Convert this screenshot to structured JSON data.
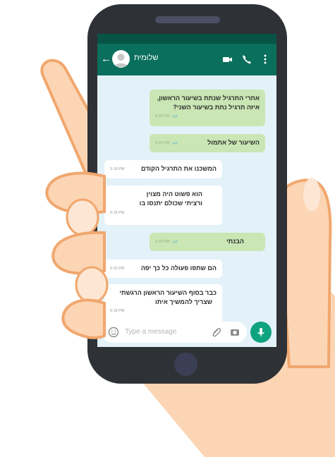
{
  "header": {
    "contact_name": "שלומית",
    "back_icon": "arrow-left-icon",
    "actions": [
      "video-call-icon",
      "phone-call-icon",
      "more-vert-icon"
    ]
  },
  "messages": [
    {
      "direction": "out",
      "lines": [
        "אחרי התרגיל שנתת בשיעור הראשון,",
        "איזה תרגיל נתת בשיעור השני?"
      ],
      "time": "5:20 PM",
      "read": true
    },
    {
      "direction": "out",
      "lines": [
        "השיעור של אתמול"
      ],
      "time": "5:20 PM",
      "read": true
    },
    {
      "direction": "in",
      "lines": [
        "המשכנו את התרגיל הקודם"
      ],
      "time": "5:18 PM"
    },
    {
      "direction": "in",
      "lines": [
        "הוא פשוט היה מצוין",
        "ורציתי שכולם יתנסו בו"
      ],
      "time": "5:18 PM"
    },
    {
      "direction": "out",
      "lines": [
        "הבנתי"
      ],
      "time": "5:20 PM",
      "read": true
    },
    {
      "direction": "in",
      "lines": [
        "הם שתפו פעולה כל כך יפה"
      ],
      "time": "5:22 PM"
    },
    {
      "direction": "in",
      "lines": [
        "כבר בסוף השיעור הראשון הרגשתי",
        "שצריך להמשיך איתו"
      ],
      "time": "5:18 PM"
    }
  ],
  "composer": {
    "placeholder": "Type a message",
    "icons": [
      "emoji-icon",
      "attach-icon",
      "camera-icon",
      "mic-icon"
    ]
  },
  "colors": {
    "header": "#0a6f5c",
    "status_bar": "#075447",
    "chat_bg": "#e3f2f8",
    "outgoing_bubble": "#c9e6b4",
    "incoming_bubble": "#ffffff",
    "mic_button": "#0fa37f",
    "phone_body": "#2e3135",
    "skin": "#fcd5b4",
    "skin_outline": "#f0a76e"
  }
}
